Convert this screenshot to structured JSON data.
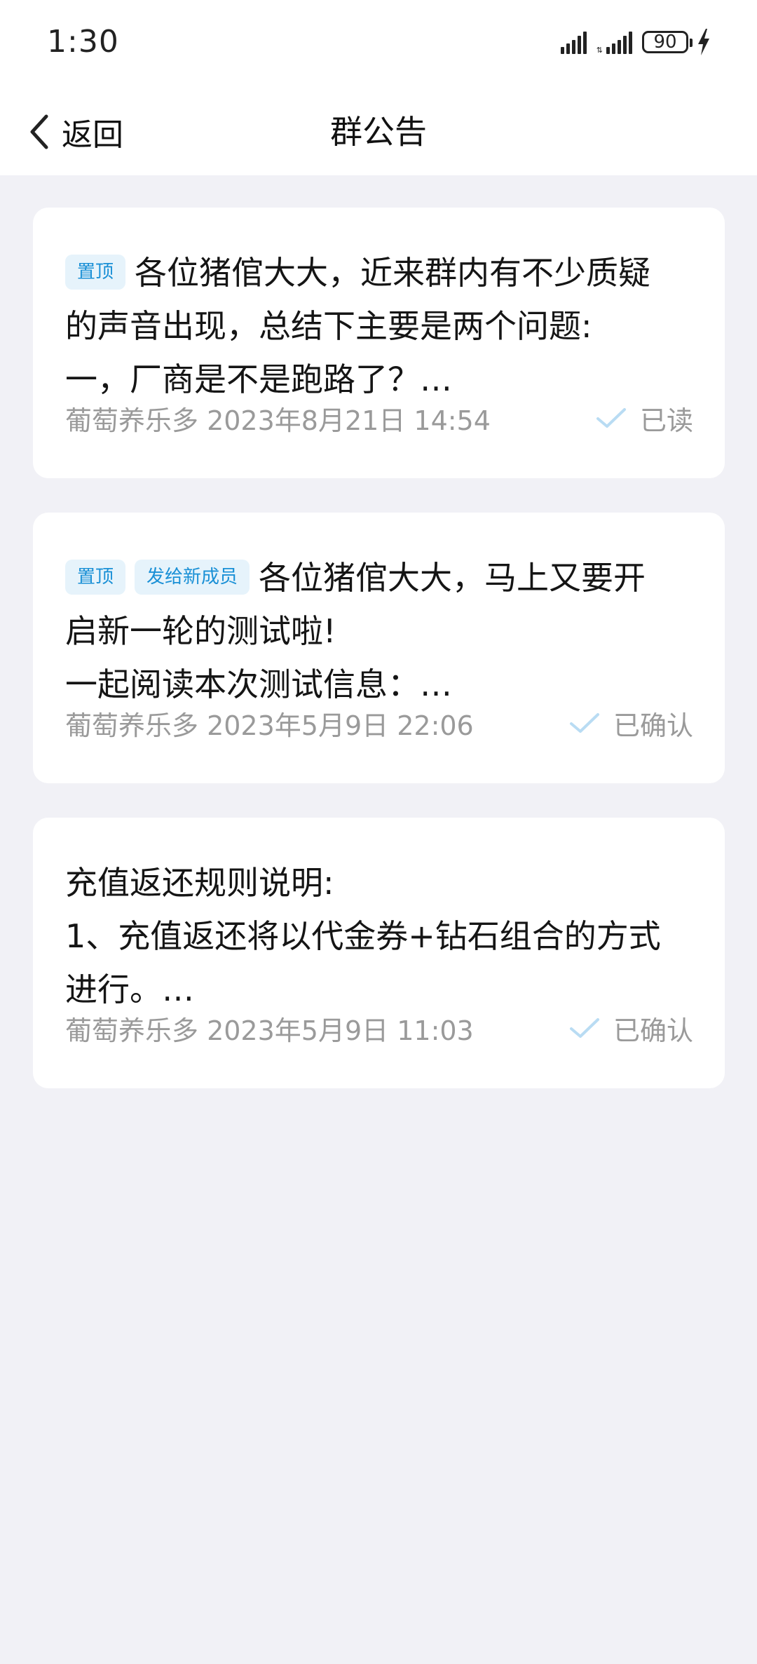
{
  "status_bar": {
    "time": "1:30",
    "battery_level": "90",
    "signal_icon": "signal-icon",
    "charging_icon": "charging-bolt-icon"
  },
  "nav": {
    "back_label": "返回",
    "title": "群公告"
  },
  "colors": {
    "tag_bg": "#e6f3fb",
    "tag_text": "#1a90d6",
    "check": "#b9dcf3",
    "page_bg": "#f1f1f6"
  },
  "announcements": [
    {
      "tags": [
        "置顶"
      ],
      "lines": [
        "各位猪倌大大，近来群内有不少质疑",
        "的声音出现，总结下主要是两个问题:",
        "一，厂商是不是跑路了？…"
      ],
      "meta": "葡萄养乐多 2023年8月21日 14:54",
      "status": "已读"
    },
    {
      "tags": [
        "置顶",
        "发给新成员"
      ],
      "lines": [
        "各位猪倌大大，马上又要开",
        "启新一轮的测试啦!",
        "一起阅读本次测试信息：…"
      ],
      "meta": "葡萄养乐多 2023年5月9日 22:06",
      "status": "已确认"
    },
    {
      "tags": [],
      "lines": [
        "充值返还规则说明:",
        "1、充值返还将以代金券+钻石组合的方式",
        "进行。…"
      ],
      "meta": "葡萄养乐多 2023年5月9日 11:03",
      "status": "已确认"
    }
  ]
}
